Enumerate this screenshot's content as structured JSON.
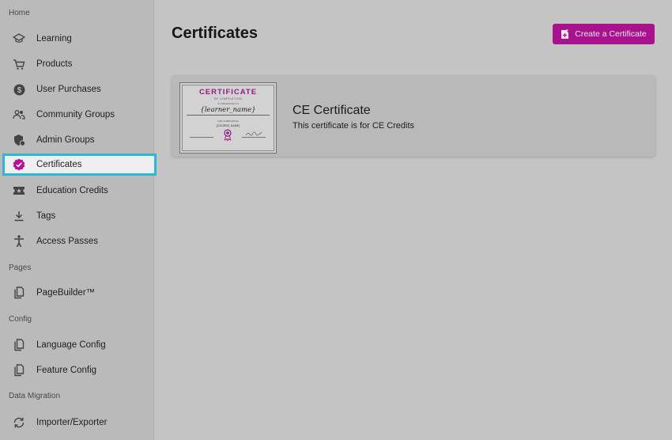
{
  "sidebar": {
    "sections": [
      {
        "label": "Home"
      },
      {
        "label": "Pages"
      },
      {
        "label": "Config"
      },
      {
        "label": "Data Migration"
      }
    ],
    "items": [
      {
        "label": "Learning",
        "icon": "graduation-cap-icon"
      },
      {
        "label": "Products",
        "icon": "cart-icon"
      },
      {
        "label": "User Purchases",
        "icon": "dollar-icon"
      },
      {
        "label": "Community Groups",
        "icon": "people-icon"
      },
      {
        "label": "Admin Groups",
        "icon": "admin-group-icon"
      },
      {
        "label": "Certificates",
        "icon": "verified-badge-icon",
        "active": true
      },
      {
        "label": "Education Credits",
        "icon": "ticket-star-icon"
      },
      {
        "label": "Tags",
        "icon": "download-icon"
      },
      {
        "label": "Access Passes",
        "icon": "accessibility-icon"
      },
      {
        "label": "PageBuilder™",
        "icon": "copy-pages-icon"
      },
      {
        "label": "Language Config",
        "icon": "copy-pages-icon"
      },
      {
        "label": "Feature Config",
        "icon": "copy-pages-icon"
      },
      {
        "label": "Importer/Exporter",
        "icon": "sync-icon"
      }
    ]
  },
  "main": {
    "title": "Certificates",
    "create_button_label": "Create a Certificate",
    "create_button_icon": "add-document-icon",
    "certificates": [
      {
        "name": "CE Certificate",
        "description": "This certificate is for CE Credits",
        "thumbnail": {
          "title": "CERTIFICATE",
          "subtitle": "OF COMPLETION",
          "presented": "IS PRESENTED TO",
          "recipient": "{learner_name}",
          "for_text": "FOR COMPLETING",
          "course": "{COURSE_NAME}"
        }
      }
    ]
  },
  "colors": {
    "accent": "#a8128f",
    "active_outline": "#29b6d8",
    "sidebar_bg": "#bababa",
    "main_bg": "#c4c4c4"
  }
}
